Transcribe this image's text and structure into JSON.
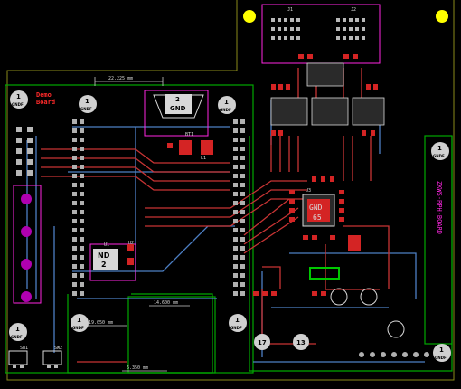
{
  "board": {
    "label_top": "Demo",
    "label_top2": "Board",
    "side_label": "ZKWS-RPH-BOARD",
    "dim_text_1": "22.225 mm",
    "dim_text_2": "19.050 mm",
    "dim_text_3": "14.600 mm",
    "dim_text_4": "6.350 mm",
    "net_gnd": "GND",
    "pad_2": "2",
    "pad_65": "65",
    "ic_nd": "ND",
    "ic_nd_2": "2",
    "mount_hole_num": "1",
    "mount_hole_sub": "GNDF",
    "ref_u1": "U1",
    "ref_u2": "U2",
    "ref_u3": "U3",
    "ref_j1": "J1",
    "ref_j2": "J2",
    "ref_sw1": "SW1",
    "ref_sw2": "SW2",
    "ref_bt1": "BT1",
    "ref_l1": "L1",
    "hole_17": "17",
    "hole_13": "13"
  },
  "colors": {
    "background": "#000000",
    "top_copper": "#c83434",
    "bottom_copper": "#4d7fc4",
    "silkscreen": "#d9d9d9",
    "edge_cuts": "#d0d000",
    "courtyard": "#ff26e2",
    "fab": "#afafaf",
    "pad": "#b8b8b8",
    "zone_green": "#00c800",
    "fiducial": "#ffff00"
  }
}
